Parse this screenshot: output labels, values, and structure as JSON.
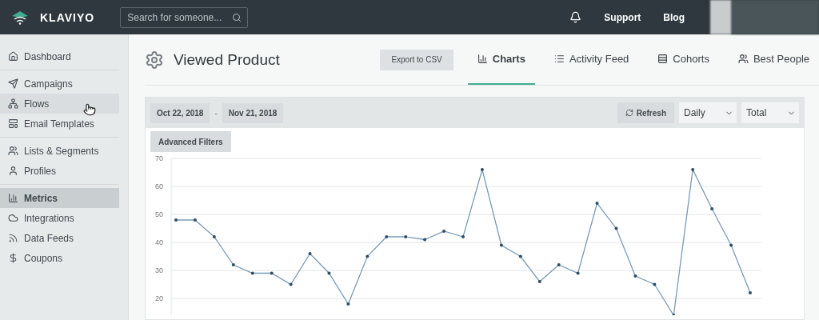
{
  "topbar": {
    "logo": "KLAVIYO",
    "search": {
      "placeholder": "Search for someone..."
    },
    "links": [
      "Support",
      "Blog"
    ]
  },
  "sidebar": {
    "groups": [
      {
        "items": [
          {
            "label": "Dashboard",
            "selected": false,
            "hovered": false
          }
        ]
      },
      {
        "items": [
          {
            "label": "Campaigns",
            "selected": false,
            "hovered": false
          },
          {
            "label": "Flows",
            "selected": false,
            "hovered": true
          },
          {
            "label": "Email Templates",
            "selected": false,
            "hovered": false
          }
        ]
      },
      {
        "items": [
          {
            "label": "Lists & Segments",
            "selected": false,
            "hovered": false
          },
          {
            "label": "Profiles",
            "selected": false,
            "hovered": false
          }
        ]
      },
      {
        "items": [
          {
            "label": "Metrics",
            "selected": true,
            "hovered": false
          },
          {
            "label": "Integrations",
            "selected": false,
            "hovered": false
          },
          {
            "label": "Data Feeds",
            "selected": false,
            "hovered": false
          },
          {
            "label": "Coupons",
            "selected": false,
            "hovered": false
          }
        ]
      }
    ]
  },
  "page": {
    "title": "Viewed Product",
    "export_button": "Export to CSV",
    "tabs": [
      {
        "label": "Charts",
        "selected": true
      },
      {
        "label": "Activity Feed",
        "selected": false
      },
      {
        "label": "Cohorts",
        "selected": false
      },
      {
        "label": "Best People",
        "selected": false
      }
    ]
  },
  "toolbar": {
    "date_from": "Oct 22, 2018",
    "separator": "-",
    "date_to": "Nov 21, 2018",
    "refresh_button": "Refresh",
    "interval": "Daily",
    "aggregate": "Total",
    "filters_button": "Advanced Filters"
  },
  "chart": {
    "chart_data": {
      "type": "line",
      "grid": true,
      "ylim": [
        14,
        70
      ],
      "yticks": [
        20,
        30,
        40,
        50,
        60,
        70
      ],
      "series": [
        {
          "color": "#7a9bb8",
          "values": [
            48,
            48,
            42,
            32,
            29,
            29,
            25,
            36,
            29,
            18,
            35,
            42,
            42,
            41,
            44,
            42,
            66,
            39,
            35,
            26,
            32,
            29,
            54,
            45,
            28,
            25,
            14,
            66,
            52,
            39,
            22
          ]
        }
      ]
    }
  }
}
